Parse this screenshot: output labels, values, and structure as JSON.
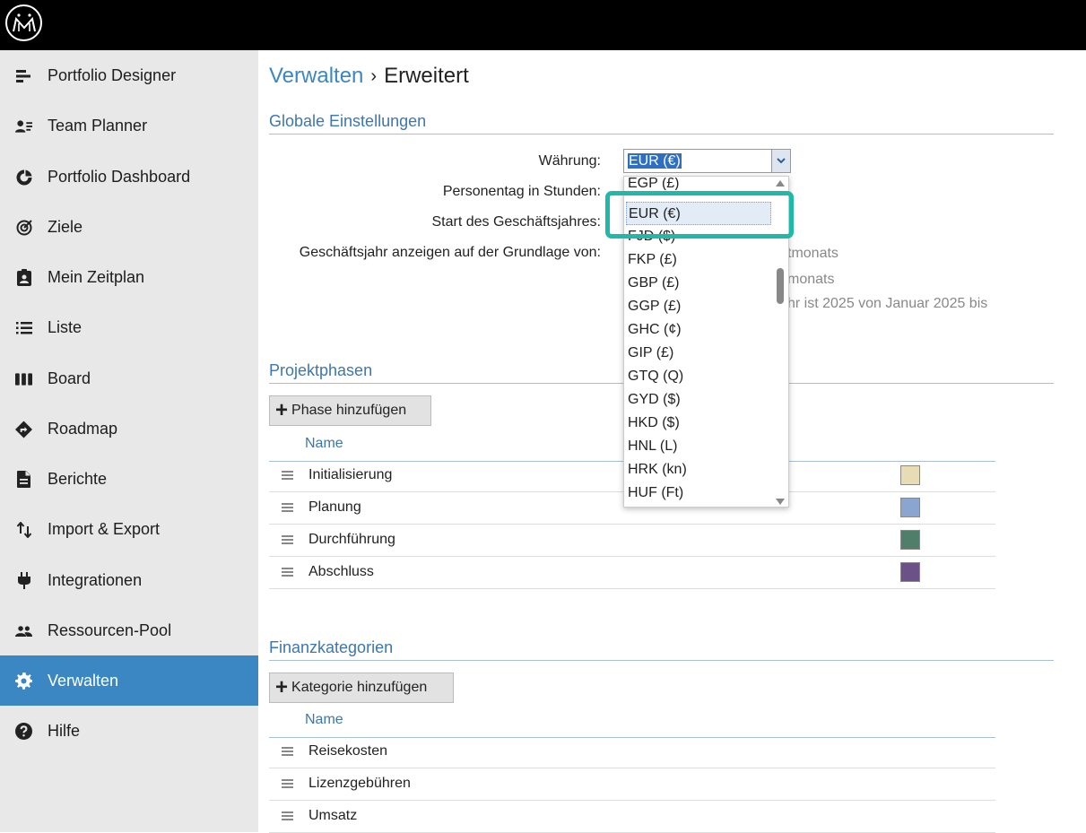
{
  "topbar": {
    "logo_icon": "app-logo-icon"
  },
  "sidebar": {
    "items": [
      {
        "label": "Portfolio Designer",
        "icon": "portfolio-designer-icon"
      },
      {
        "label": "Team Planner",
        "icon": "team-planner-icon"
      },
      {
        "label": "Portfolio Dashboard",
        "icon": "dashboard-icon"
      },
      {
        "label": "Ziele",
        "icon": "target-icon"
      },
      {
        "label": "Mein Zeitplan",
        "icon": "clipboard-user-icon"
      },
      {
        "label": "Liste",
        "icon": "list-icon"
      },
      {
        "label": "Board",
        "icon": "board-icon"
      },
      {
        "label": "Roadmap",
        "icon": "roadmap-icon"
      },
      {
        "label": "Berichte",
        "icon": "document-icon"
      },
      {
        "label": "Import & Export",
        "icon": "import-export-icon"
      },
      {
        "label": "Integrationen",
        "icon": "plug-icon"
      },
      {
        "label": "Ressourcen-Pool",
        "icon": "people-icon"
      },
      {
        "label": "Verwalten",
        "icon": "gear-icon",
        "active": true
      },
      {
        "label": "Hilfe",
        "icon": "help-icon"
      }
    ],
    "active_color": "#3a87c4"
  },
  "breadcrumb": {
    "parent": "Verwalten",
    "separator": "›",
    "current": "Erweitert"
  },
  "global_settings": {
    "title": "Globale Einstellungen",
    "currency_label": "Währung:",
    "currency_value": "EUR (€)",
    "person_day_label": "Personentag in Stunden:",
    "fiscal_start_label": "Start des Geschäftsjahres:",
    "fiscal_display_label": "Geschäftsjahr anzeigen auf der Grundlage von:",
    "partial_option_1": "tmonats",
    "partial_option_2": "monats",
    "partial_note": "hr ist 2025 von Januar 2025 bis"
  },
  "currency_dropdown": {
    "options": [
      "EGP (£)",
      "EUR (€)",
      "FJD ($)",
      "FKP (£)",
      "GBP (£)",
      "GGP (£)",
      "GHC (¢)",
      "GIP (£)",
      "GTQ (Q)",
      "GYD ($)",
      "HKD ($)",
      "HNL (L)",
      "HRK (kn)",
      "HUF (Ft)"
    ],
    "selected": "EUR (€)",
    "highlight_color": "#1fb8a9"
  },
  "phases": {
    "title": "Projektphasen",
    "add_button": "Phase hinzufügen",
    "column_name": "Name",
    "rows": [
      {
        "name": "Initialisierung",
        "color": "#e8dcb4"
      },
      {
        "name": "Planung",
        "color": "#8aa6d0"
      },
      {
        "name": "Durchführung",
        "color": "#4f7e6a"
      },
      {
        "name": "Abschluss",
        "color": "#6c5088"
      }
    ]
  },
  "finance": {
    "title": "Finanzkategorien",
    "add_button": "Kategorie hinzufügen",
    "column_name": "Name",
    "rows": [
      {
        "name": "Reisekosten"
      },
      {
        "name": "Lizenzgebühren"
      },
      {
        "name": "Umsatz"
      }
    ]
  }
}
